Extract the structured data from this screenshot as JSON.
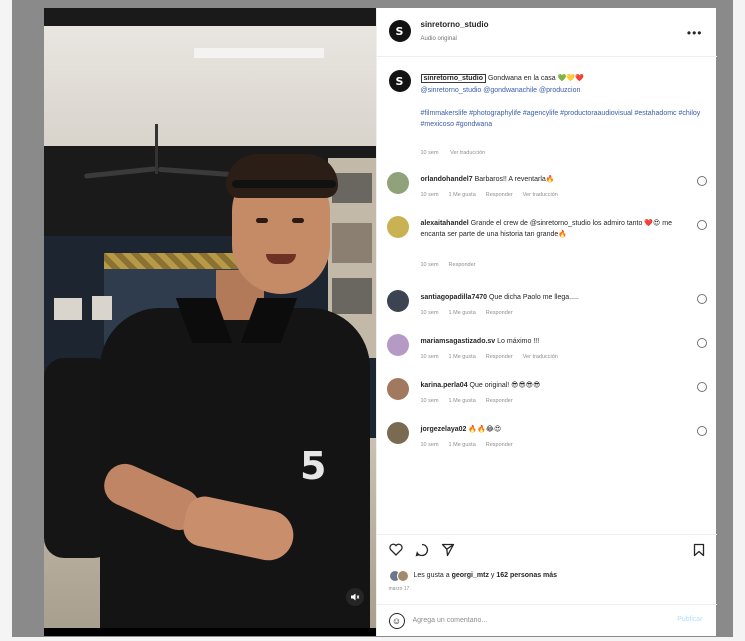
{
  "header": {
    "username": "sinretorno_studio",
    "audio": "Audio original"
  },
  "caption": {
    "username": "sinretorno_studio",
    "text_rest": "Gondwana en la casa 💚💛❤️",
    "mention_1": "@sinretorno_studio",
    "mention_2": "@gondwanachile",
    "mention_3": "@produzcion",
    "hashtags": "#filmmakerslife #photographylife #agencylife #productoraaudiovisual #estahadomc #chiloy #mexicoso #gondwana",
    "time": "10 sem",
    "translation": "Ver traducción"
  },
  "comments": [
    {
      "user": "orlandohandel7",
      "text": "Barbaros!! A reventarla🔥",
      "time": "10 sem",
      "likes": "1 Me gusta",
      "reply": "Responder",
      "translation": "Ver traducción"
    },
    {
      "user": "alexaitahandel",
      "text": "Grande el crew de @sinretorno_studio los admiro tanto ❤️😍 me encanta ser parte de una historia tan grande🔥",
      "time": "10 sem",
      "likes": "",
      "reply": "Responder",
      "translation": ""
    },
    {
      "user": "santiagopadilla7470",
      "text": "Que dicha Paolo me llega.....",
      "time": "10 sem",
      "likes": "1 Me gusta",
      "reply": "Responder",
      "translation": ""
    },
    {
      "user": "mariamsagastizado.sv",
      "text": "Lo máximo !!!",
      "time": "10 sem",
      "likes": "1 Me gusta",
      "reply": "Responder",
      "translation": "Ver traducción"
    },
    {
      "user": "karina.perla04",
      "text": "Que original! 😎😎😎😎",
      "time": "10 sem",
      "likes": "1 Me gusta",
      "reply": "Responder",
      "translation": ""
    },
    {
      "user": "jorgezelaya02",
      "text": "🔥🔥😂😍",
      "time": "10 sem",
      "likes": "1 Me gusta",
      "reply": "Responder",
      "translation": ""
    }
  ],
  "likes": {
    "prefix": "Les gusta a",
    "user": "georgi_mtz",
    "connector": "y",
    "count": "162 personas más"
  },
  "date": "marzo 17",
  "add_comment": {
    "placeholder": "Agrega un comentario...",
    "publish": "Publicar"
  },
  "icons": {
    "like": "heart-icon",
    "comment": "comment-icon",
    "share": "share-icon",
    "save": "bookmark-icon",
    "emoji": "emoji-icon",
    "audio": "audio-icon",
    "more": "more-icon"
  },
  "colors": {
    "link": "#3a5da8",
    "muted": "#8e8e8e",
    "text": "#262626",
    "publish_disabled": "#b2dffc"
  }
}
